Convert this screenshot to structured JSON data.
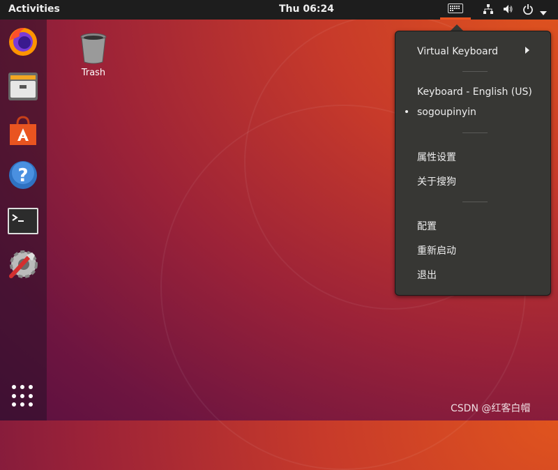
{
  "topbar": {
    "activities": "Activities",
    "clock": "Thu 06:24"
  },
  "desktop": {
    "trash_label": "Trash"
  },
  "dock": {
    "items": [
      "firefox-icon",
      "files-icon",
      "software-icon",
      "help-icon",
      "terminal-icon",
      "settings-icon"
    ]
  },
  "menu": {
    "virtual_keyboard": "Virtual Keyboard",
    "keyboard_layout": "Keyboard - English (US)",
    "sogoupinyin": "sogoupinyin",
    "properties": "属性设置",
    "about": "关于搜狗",
    "config": "配置",
    "restart": "重新启动",
    "quit": "退出"
  },
  "watermark": "CSDN @红客白帽",
  "colors": {
    "accent": "#e95420",
    "topbar": "#1d1d1d",
    "menu_bg": "#373734"
  }
}
